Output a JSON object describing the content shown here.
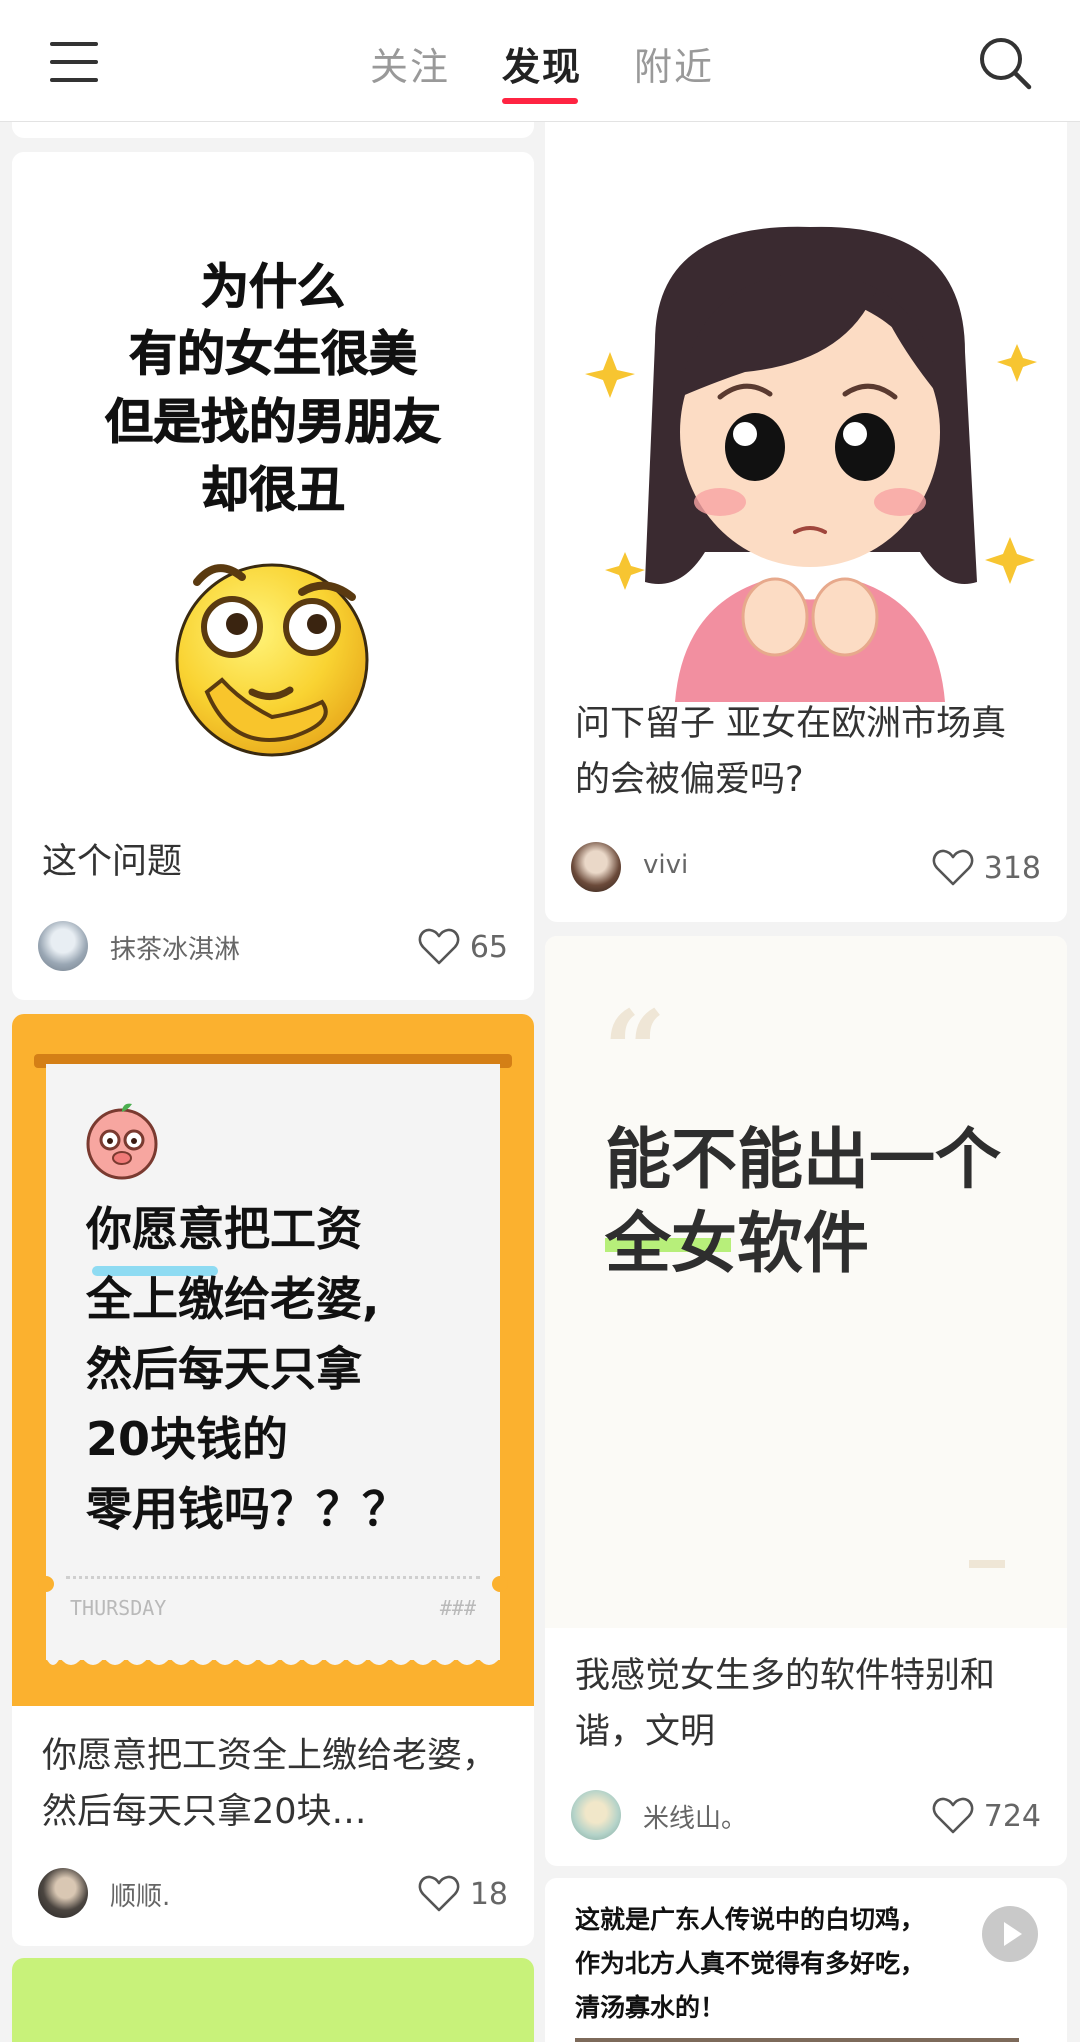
{
  "header": {
    "tabs": [
      {
        "label": "关注"
      },
      {
        "label": "发现"
      },
      {
        "label": "附近"
      }
    ],
    "accent_color": "#ff2442"
  },
  "feed": {
    "cards": [
      {
        "cover_lines": [
          "为什么",
          "有的女生很美",
          "但是找的男朋友",
          "却很丑"
        ],
        "title": "这个问题",
        "author": "抹茶冰淇淋",
        "likes": "65"
      },
      {
        "title": "问下留子 亚女在欧洲市场真的会被偏爱吗?",
        "author": "vivi",
        "likes": "318"
      },
      {
        "cover_lines": [
          "你愿意把工资",
          "全上缴给老婆,",
          "然后每天只拿",
          "20块钱的",
          "零用钱吗？？？"
        ],
        "cover_footer_left": "THURSDAY",
        "cover_footer_right": "###",
        "title": "你愿意把工资全上缴给老婆，然后每天只拿20块…",
        "author": "顺顺.",
        "likes": "18"
      },
      {
        "quote_mark": "“",
        "cover_lines": [
          "能不能出一个",
          "全女软件"
        ],
        "title": "我感觉女生多的软件特别和谐，文明",
        "author": "米线山。",
        "likes": "724"
      },
      {
        "cover_lines": [
          "这就是广东人传说中的白切鸡，",
          "作为北方人真不觉得有多好吃，",
          "清汤寡水的！"
        ]
      }
    ]
  }
}
